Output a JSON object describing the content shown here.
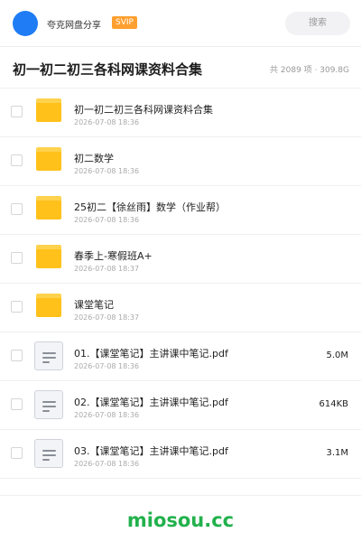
{
  "header": {
    "share_user": "夸克网盘分享",
    "badge": "SVIP",
    "search_label": "搜索"
  },
  "title_bar": {
    "title": "初一初二初三各科网课资料合集",
    "summary": "共 2089 项 · 309.8G"
  },
  "files": [
    {
      "type": "folder",
      "icon": "folder-icon",
      "name": "初一初二初三各科网课资料合集",
      "date": "2026-07-08 18:36",
      "size": ""
    },
    {
      "type": "folder",
      "icon": "folder-icon",
      "name": "初二数学",
      "date": "2026-07-08 18:36",
      "size": ""
    },
    {
      "type": "folder",
      "icon": "folder-icon",
      "name": "25初二【徐丝雨】数学（作业帮）",
      "date": "2026-07-08 18:36",
      "size": ""
    },
    {
      "type": "folder",
      "icon": "folder-icon",
      "name": "春季上-寒假班A+",
      "date": "2026-07-08 18:37",
      "size": ""
    },
    {
      "type": "folder",
      "icon": "folder-icon",
      "name": "课堂笔记",
      "date": "2026-07-08 18:37",
      "size": ""
    },
    {
      "type": "file",
      "icon": "document-icon",
      "name": "01.【课堂笔记】主讲课中笔记.pdf",
      "date": "2026-07-08 18:36",
      "size": "5.0M"
    },
    {
      "type": "file",
      "icon": "document-icon",
      "name": "02.【课堂笔记】主讲课中笔记.pdf",
      "date": "2026-07-08 18:36",
      "size": "614KB"
    },
    {
      "type": "file",
      "icon": "document-icon",
      "name": "03.【课堂笔记】主讲课中笔记.pdf",
      "date": "2026-07-08 18:36",
      "size": "3.1M"
    }
  ],
  "watermark": "miosou.cc",
  "colors": {
    "accent": "#1f7cf5",
    "badge": "#ff9f2f",
    "folder": "#ffc11a",
    "watermark": "#22b14c"
  }
}
